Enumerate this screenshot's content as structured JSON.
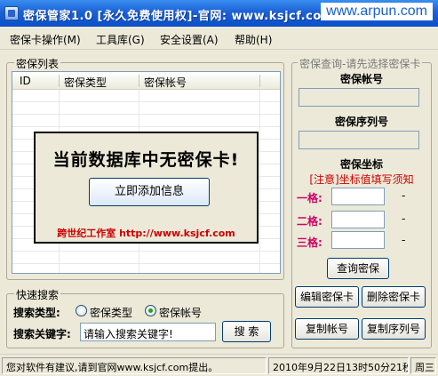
{
  "titlebar": {
    "title": "密保管家1.0 [永久免费使用权]-官网: www.ksjcf.com",
    "watermark": "www.arpun.com"
  },
  "menu": [
    {
      "label": "密保卡操作(M)"
    },
    {
      "label": "工具库(G)"
    },
    {
      "label": "安全设置(A)"
    },
    {
      "label": "帮助(H)"
    }
  ],
  "list": {
    "group_title": "密保列表",
    "columns": [
      "ID",
      "密保类型",
      "密保帐号"
    ]
  },
  "message": {
    "text": "当前数据库中无密保卡!",
    "button": "立即添加信息",
    "credit": "跨世纪工作室 http://www.ksjcf.com"
  },
  "query": {
    "group_title": "密保查询-请先选择密保卡",
    "account_label": "密保帐号",
    "serial_label": "密保序列号",
    "coord_label": "密保坐标",
    "notice": "[注意]坐标值填写须知",
    "coords": [
      "一格:",
      "二格:",
      "三格:"
    ],
    "dash": "-",
    "query_button": "查询密保",
    "edit_button": "编辑密保卡",
    "delete_button": "删除密保卡",
    "copy_account_button": "复制帐号",
    "copy_serial_button": "复制序列号"
  },
  "search": {
    "group_title": "快速搜索",
    "type_label": "搜索类型:",
    "options": [
      "密保类型",
      "密保帐号"
    ],
    "selected": "密保帐号",
    "keyword_label": "搜索关键字:",
    "keyword_value": "请输入搜索关键字!",
    "button": "搜 索"
  },
  "status": {
    "message": "您对软件有建议,请到官网www.ksjcf.com提出。",
    "datetime": "2010年9月22日13时50分21秒",
    "weekday": "周三"
  }
}
